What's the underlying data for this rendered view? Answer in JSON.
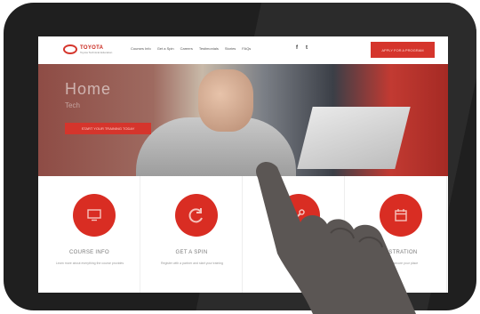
{
  "brand": {
    "logo_text": "TOYOTA",
    "logo_sub": "Toyota Technical Education"
  },
  "nav": {
    "links": [
      "Courses Info",
      "Get a Spin",
      "Careers",
      "Testimonials",
      "Stories",
      "FAQs"
    ],
    "social": [
      "f",
      "t"
    ],
    "cta_label": "APPLY FOR A PROGRAM"
  },
  "hero": {
    "title": "Home",
    "subtitle": "Tech",
    "button_label": "START YOUR TRAINING TODAY"
  },
  "features": [
    {
      "title": "COURSE INFO",
      "desc": "Learn more about everything the course provides",
      "icon": "monitor-icon"
    },
    {
      "title": "GET A SPIN",
      "desc": "Register with a partner and start your training",
      "icon": "refresh-icon"
    },
    {
      "title": "",
      "desc": "",
      "icon": "wrench-icon"
    },
    {
      "title": "REGISTRATION",
      "desc": "Register and secure your place",
      "icon": "calendar-icon"
    }
  ],
  "colors": {
    "accent": "#d92d23",
    "device": "#1f1f1f"
  }
}
